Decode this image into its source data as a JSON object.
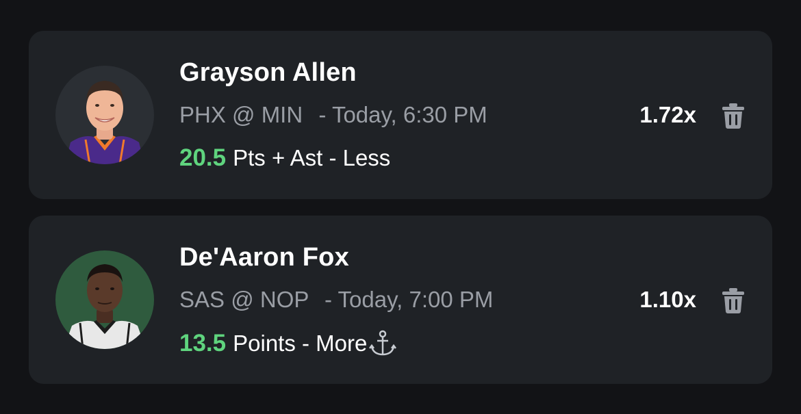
{
  "picks": [
    {
      "player": "Grayson Allen",
      "matchup": "PHX @ MIN",
      "separator": "-",
      "time": "Today, 6:30 PM",
      "line_value": "20.5",
      "stat": "Pts + Ast - Less",
      "multiplier": "1.72x",
      "jersey_color": "#4a2a8a"
    },
    {
      "player": "De'Aaron Fox",
      "matchup": "SAS @ NOP",
      "separator": "-",
      "time": "Today, 7:00 PM",
      "line_value": "13.5",
      "stat": "Points - More",
      "multiplier": "1.10x",
      "jersey_color": "#e8e8e8"
    }
  ],
  "colors": {
    "background": "#121316",
    "card": "#1f2226",
    "accent_green": "#5fd47e",
    "muted_text": "#9a9ea5"
  },
  "icons": {
    "delete": "trash-icon",
    "anchor": "anchor-icon"
  }
}
